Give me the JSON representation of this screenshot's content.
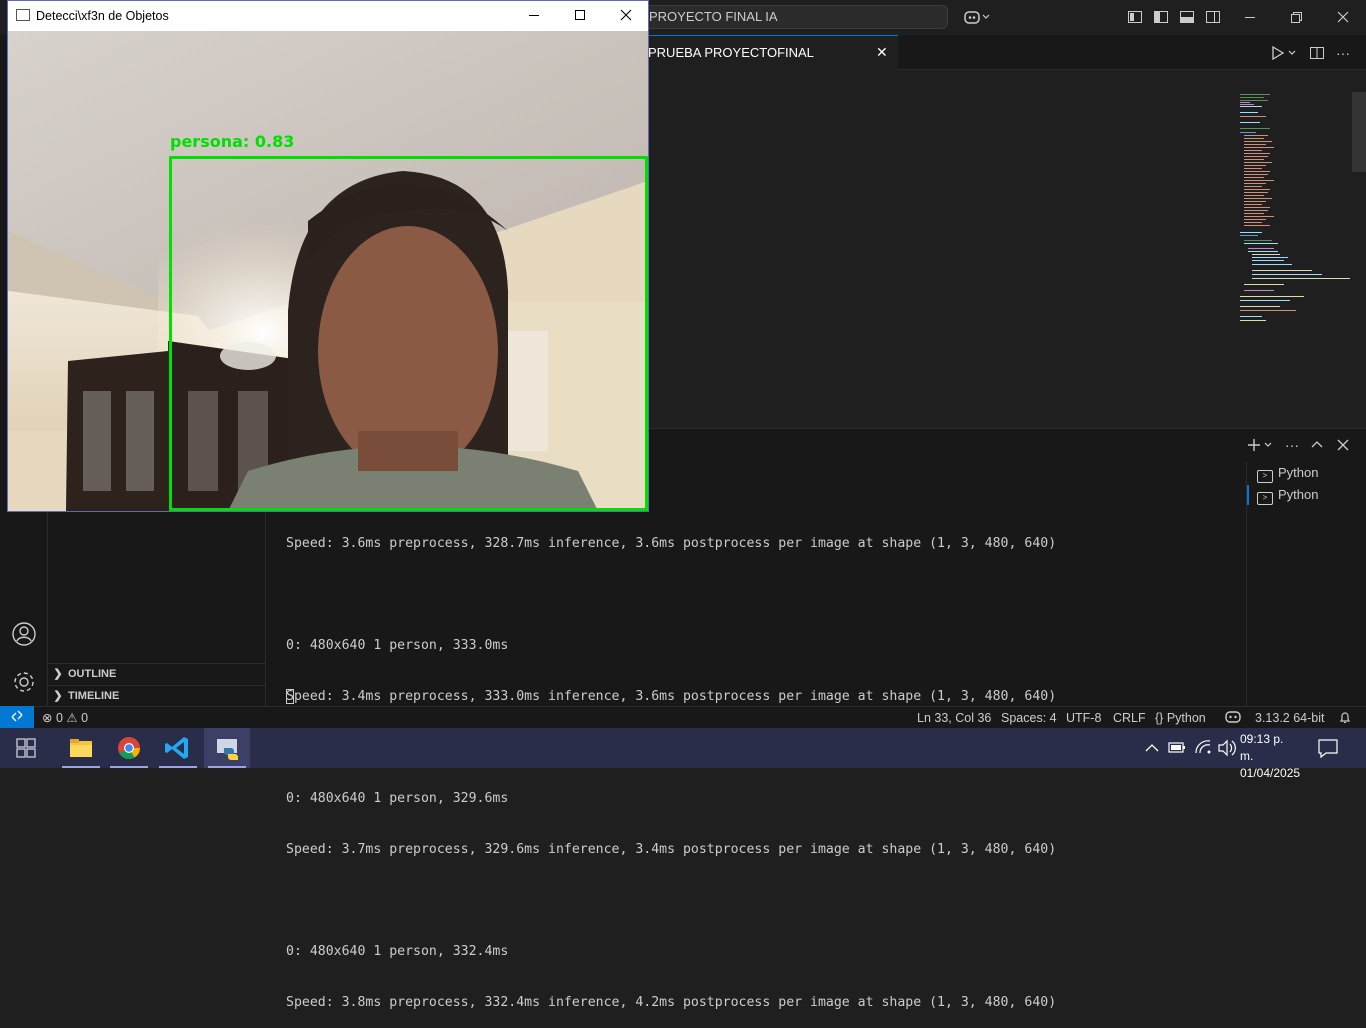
{
  "vscode": {
    "command_center": "PROYECTO FINAL IA",
    "active_tab": "PRUEBA PROYECTOFINAL ANA_CEJA.py",
    "sidebar_sections": [
      "OUTLINE",
      "TIMELINE"
    ],
    "terminal": {
      "lines": [
        "Speed: 3.6ms preprocess, 328.7ms inference, 3.6ms postprocess per image at shape (1, 3, 480, 640)",
        "",
        "0: 480x640 1 person, 333.0ms",
        "Speed: 3.4ms preprocess, 333.0ms inference, 3.6ms postprocess per image at shape (1, 3, 480, 640)",
        "",
        "0: 480x640 1 person, 329.6ms",
        "Speed: 3.7ms preprocess, 329.6ms inference, 3.4ms postprocess per image at shape (1, 3, 480, 640)",
        "",
        "0: 480x640 1 person, 332.4ms",
        "Speed: 3.8ms preprocess, 332.4ms inference, 4.2ms postprocess per image at shape (1, 3, 480, 640)"
      ],
      "sessions": [
        "Python",
        "Python"
      ]
    },
    "status": {
      "errors": "0",
      "warnings": "0",
      "position": "Ln 33, Col 36",
      "spaces": "Spaces: 4",
      "encoding": "UTF-8",
      "eol": "CRLF",
      "language": "Python",
      "interpreter": "3.13.2 64-bit"
    }
  },
  "detection_window": {
    "title": "Detecci\\xf3n de Objetos",
    "label": "persona: 0.83",
    "confidence": 0.83,
    "box_color": "#00e000"
  },
  "taskbar": {
    "apps": [
      "windows-start",
      "file-explorer",
      "chrome",
      "vscode",
      "python"
    ],
    "time": "09:13 p. m.",
    "date": "01/04/2025"
  },
  "colors": {
    "accent": "#0078d4",
    "editor_bg": "#1f1f1f",
    "taskbar_bg": "#2a2d4a"
  }
}
